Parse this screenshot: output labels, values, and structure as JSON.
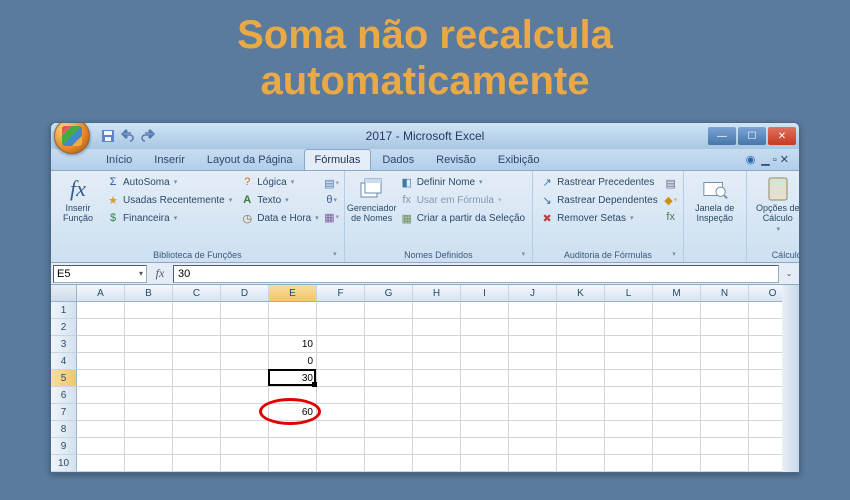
{
  "banner": {
    "line1": "Soma não recalcula",
    "line2": "automaticamente"
  },
  "titlebar": {
    "title": "2017 - Microsoft Excel"
  },
  "tabs": {
    "items": [
      "Início",
      "Inserir",
      "Layout da Página",
      "Fórmulas",
      "Dados",
      "Revisão",
      "Exibição"
    ],
    "active_index": 3
  },
  "ribbon": {
    "insert_function": "Inserir Função",
    "library": {
      "autosoma": "AutoSoma",
      "usadas": "Usadas Recentemente",
      "financeira": "Financeira",
      "logica": "Lógica",
      "texto": "Texto",
      "data_hora": "Data e Hora",
      "label": "Biblioteca de Funções"
    },
    "names": {
      "manager": "Gerenciador de Nomes",
      "define": "Definir Nome",
      "use": "Usar em Fórmula",
      "create": "Criar a partir da Seleção",
      "label": "Nomes Definidos"
    },
    "audit": {
      "precedents": "Rastrear Precedentes",
      "dependents": "Rastrear Dependentes",
      "remove_arrows": "Remover Setas",
      "label": "Auditoria de Fórmulas"
    },
    "watch": {
      "btn": "Janela de Inspeção"
    },
    "calc": {
      "btn": "Opções de Cálculo",
      "label": "Cálculo"
    }
  },
  "formula_bar": {
    "name_box": "E5",
    "value": "30"
  },
  "sheet": {
    "columns": [
      "A",
      "B",
      "C",
      "D",
      "E",
      "F",
      "G",
      "H",
      "I",
      "J",
      "K",
      "L",
      "M",
      "N",
      "O"
    ],
    "rows": 10,
    "active_col_index": 4,
    "active_row": 5,
    "cells": {
      "E3": "10",
      "E4": "0",
      "E5": "30",
      "E7": "60"
    },
    "highlight_cell": "E7"
  }
}
